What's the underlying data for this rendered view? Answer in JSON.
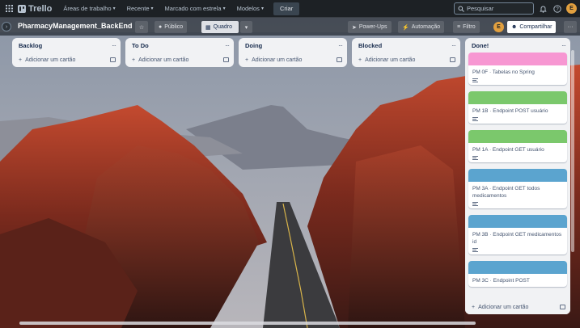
{
  "topbar": {
    "brand": "Trello",
    "menus": [
      {
        "label": "Áreas de trabalho"
      },
      {
        "label": "Recente"
      },
      {
        "label": "Marcado com estrela"
      },
      {
        "label": "Modelos"
      }
    ],
    "create_label": "Criar",
    "search_placeholder": "Pesquisar",
    "user_initial": "E"
  },
  "board": {
    "title": "PharmacyManagement_BackEnd",
    "visibility_label": "Público",
    "view_label": "Quadro",
    "powerups_label": "Power-Ups",
    "automation_label": "Automação",
    "filter_label": "Filtro",
    "member_initial": "E",
    "share_label": "Compartilhar"
  },
  "lists": [
    {
      "title": "Backlog",
      "add_label": "Adicionar um cartão"
    },
    {
      "title": "To Do",
      "add_label": "Adicionar um cartão"
    },
    {
      "title": "Doing",
      "add_label": "Adicionar um cartão"
    },
    {
      "title": "Blocked",
      "add_label": "Adicionar um cartão"
    }
  ],
  "done": {
    "title": "Done!",
    "add_label": "Adicionar um cartão",
    "cards": [
      {
        "title": "PM 0F · Tabelas no Spring",
        "cover": "#f797d2"
      },
      {
        "title": "PM 1B · Endpoint POST usuário",
        "cover": "#7bc86c"
      },
      {
        "title": "PM 1A · Endpoint GET usuário",
        "cover": "#7bc86c"
      },
      {
        "title": "PM 3A · Endpoint GET todos medicamentos",
        "cover": "#5ba4cf"
      },
      {
        "title": "PM 3B · Endpoint GET medicamentos id",
        "cover": "#5ba4cf"
      },
      {
        "title": "PM 3C · Endpoint POST",
        "cover": "#5ba4cf"
      }
    ]
  }
}
